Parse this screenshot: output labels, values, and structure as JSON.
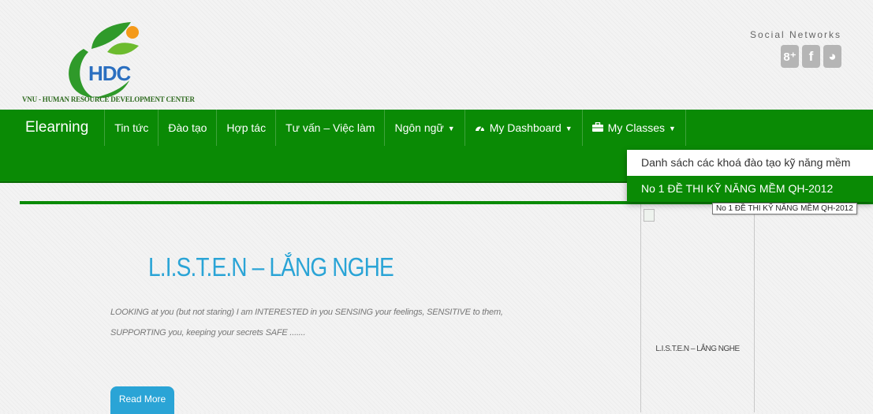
{
  "header": {
    "logo_text": "HDC",
    "logo_caption": "VNU - HUMAN RESOURCE DEVELOPMENT CENTER",
    "social_title": "Social Networks",
    "social_icons": [
      {
        "name": "google-plus-icon",
        "glyph": "8⁺"
      },
      {
        "name": "facebook-icon",
        "glyph": "f"
      },
      {
        "name": "globe-icon",
        "glyph": "◕"
      }
    ]
  },
  "nav": {
    "brand": "Elearning",
    "items": [
      {
        "label": "Tin tức"
      },
      {
        "label": "Đào tạo"
      },
      {
        "label": "Hợp tác"
      },
      {
        "label": "Tư vấn – Việc làm"
      },
      {
        "label": "Ngôn ngữ"
      },
      {
        "label": "My Dashboard",
        "icon": "dashboard-icon"
      },
      {
        "label": "My Classes",
        "icon": "briefcase-icon"
      }
    ]
  },
  "dropdown": {
    "items": [
      {
        "label": "Danh sách các khoá đào tạo kỹ năng mềm"
      },
      {
        "label": "No 1 ĐỀ THI KỸ NĂNG MỀM QH-2012",
        "active": true
      }
    ],
    "tooltip": "No 1 ĐỀ THI KỸ NĂNG MỀM QH-2012"
  },
  "slide": {
    "title": "L.I.S.T.E.N – LẮNG NGHE",
    "text": "LOOKING at you (but not staring) I am INTERESTED in you SENSING your feelings, SENSITIVE to them, SUPPORTING you, keeping your secrets SAFE .......",
    "button": "Read More",
    "thumb_caption": "L.I.S.T.E.N – LẮNG NGHE"
  },
  "colors": {
    "nav_green": "#0a8a05",
    "accent_blue": "#2aa4d6"
  }
}
